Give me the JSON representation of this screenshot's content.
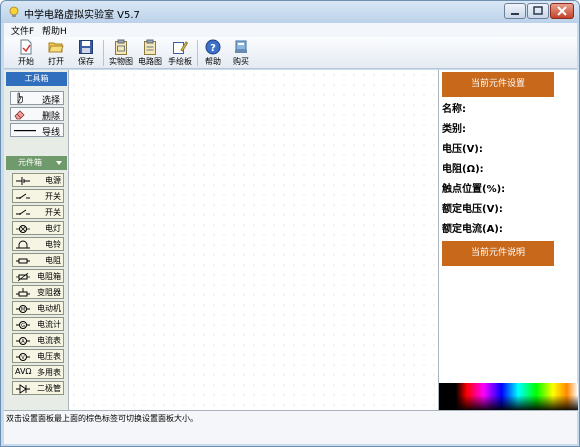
{
  "window": {
    "title": "中学电路虚拟实验室 V5.7"
  },
  "menu": [
    "文件F",
    "帮助H"
  ],
  "toolbar": [
    {
      "label": "开始",
      "icon": "new-file-icon"
    },
    {
      "label": "打开",
      "icon": "open-folder-icon"
    },
    {
      "label": "保存",
      "icon": "save-disk-icon"
    },
    {
      "label": "实物图",
      "icon": "clipboard-icon"
    },
    {
      "label": "电路图",
      "icon": "clipboard-icon"
    },
    {
      "label": "手绘板",
      "icon": "pencil-board-icon"
    },
    {
      "label": "帮助",
      "icon": "help-icon"
    },
    {
      "label": "购买",
      "icon": "cart-icon"
    }
  ],
  "toolbox": {
    "header": "工具箱",
    "items": [
      "选择",
      "删除",
      "导线"
    ]
  },
  "components": {
    "header": "元件箱",
    "items": [
      {
        "label": "电源",
        "symbol": "battery"
      },
      {
        "label": "开关",
        "symbol": "switch"
      },
      {
        "label": "开关",
        "symbol": "switch"
      },
      {
        "label": "电灯",
        "symbol": "lamp"
      },
      {
        "label": "电铃",
        "symbol": "bell"
      },
      {
        "label": "电阻",
        "symbol": "resistor"
      },
      {
        "label": "电阻箱",
        "symbol": "resistor-box"
      },
      {
        "label": "变阻器",
        "symbol": "rheostat"
      },
      {
        "label": "电动机",
        "symbol": "motor"
      },
      {
        "label": "电流计",
        "symbol": "galvanometer"
      },
      {
        "label": "电流表",
        "symbol": "ammeter"
      },
      {
        "label": "电压表",
        "symbol": "voltmeter"
      },
      {
        "label": "多用表",
        "symbol": "multimeter",
        "prefix": "AVΩ"
      },
      {
        "label": "二极管",
        "symbol": "diode"
      }
    ]
  },
  "properties": {
    "header": "当前元件设置",
    "items": [
      "名称:",
      "类别:",
      "电压(V):",
      "电阻(Ω):",
      "触点位置(%):",
      "额定电压(V):",
      "额定电流(A):"
    ],
    "description_header": "当前元件说明"
  },
  "status": "双击设置面板最上面的棕色标签可切换设置面板大小。",
  "colors": {
    "accent_orange": "#c8681a",
    "toolbox_blue": "#2f6fbe",
    "component_green": "#6f9a6c"
  }
}
